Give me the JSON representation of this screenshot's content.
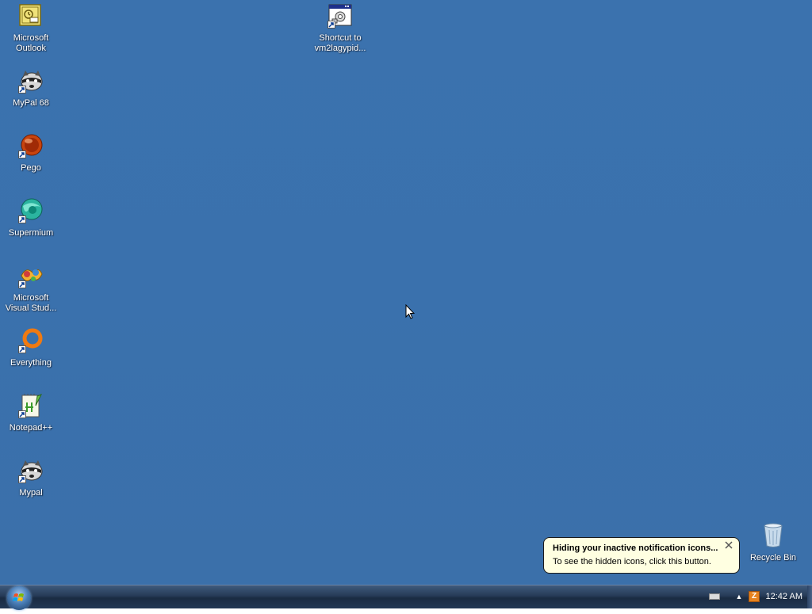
{
  "desktop": {
    "icons": [
      {
        "label": "Microsoft\nOutlook",
        "icon": "outlook-icon"
      },
      {
        "label": "MyPal 68",
        "icon": "raccoon-icon"
      },
      {
        "label": "Pego",
        "icon": "pego-icon"
      },
      {
        "label": "Supermium",
        "icon": "supermium-icon"
      },
      {
        "label": "Microsoft\nVisual Stud...",
        "icon": "visual-studio-icon"
      },
      {
        "label": "Everything",
        "icon": "everything-icon"
      },
      {
        "label": "Notepad++",
        "icon": "notepad-plus-plus-icon"
      },
      {
        "label": "Mypal",
        "icon": "raccoon-icon"
      },
      {
        "label": "Shortcut to\nvm2lagypid...",
        "icon": "program-window-icon"
      },
      {
        "label": "Recycle Bin",
        "icon": "recycle-bin-icon"
      }
    ]
  },
  "notification": {
    "title": "Hiding your inactive notification icons...",
    "text": "To see the hidden icons, click this button.",
    "close_icon": "close-icon"
  },
  "taskbar": {
    "start_icon": "windows-start-orb-icon",
    "tray": {
      "keyboard_icon": "keyboard-icon",
      "chevron_icon": "chevron-up-icon",
      "app_icon": "tray-app-icon",
      "clock": "12:42 AM"
    }
  },
  "colors": {
    "desktop_bg": "#3a6ea5",
    "taskbar_bg": "#223754",
    "balloon_bg": "#ffffe1"
  }
}
